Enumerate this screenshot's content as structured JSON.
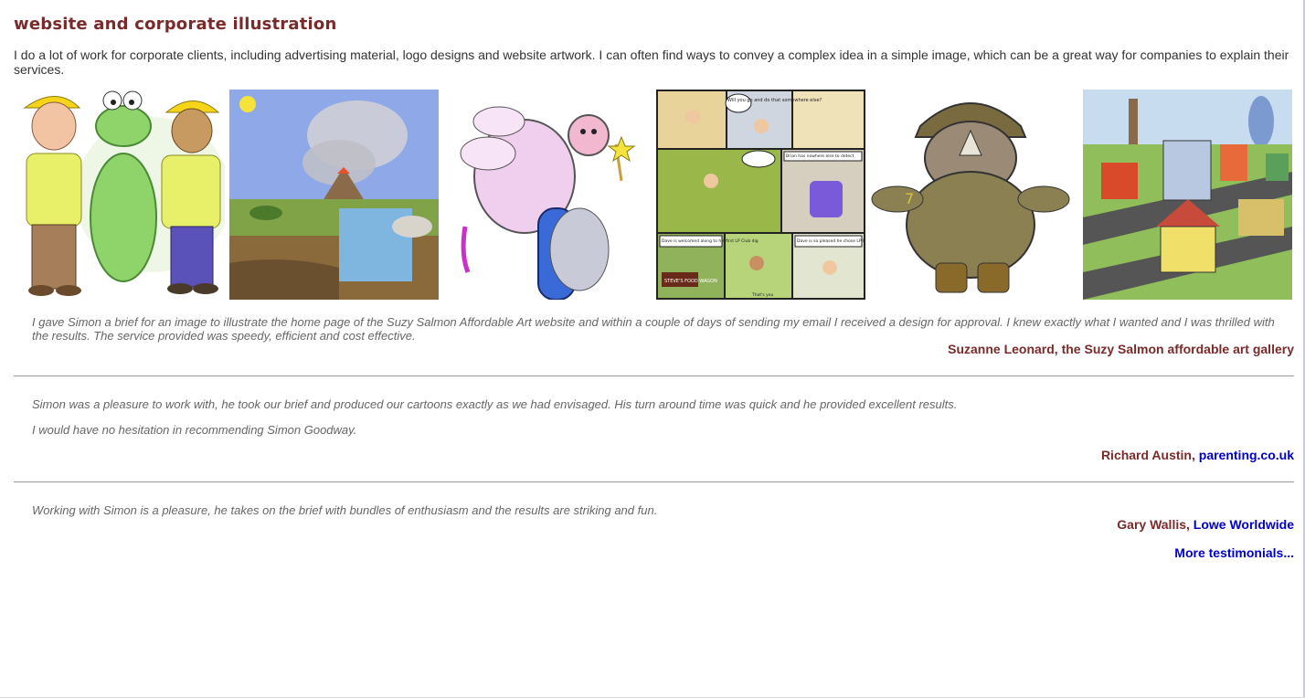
{
  "heading": "website and corporate illustration",
  "intro": "I do a lot of work for corporate clients, including advertising material, logo designs and website artwork. I can often find ways to convey a complex idea in a simple image, which can be a great way for companies to explain their services.",
  "gallery": [
    {
      "icon": "construction-workers-crocodile-icon"
    },
    {
      "icon": "prehistoric-volcano-landscape-icon"
    },
    {
      "icon": "flying-pig-fairy-icon"
    },
    {
      "icon": "comic-strip-icon",
      "captions": [
        "Will you go and do that somewhere else?",
        "Brian has nowhere else to detect",
        "Dave is welcomed along to his first LP Club dig",
        "Dave is so pleased he chose LP Metal Detecting",
        "STEVE'S FOOD WAGON",
        "That's you"
      ]
    },
    {
      "icon": "rhino-soldier-icon",
      "badge": "7"
    },
    {
      "icon": "london-city-aerial-icon"
    }
  ],
  "testimonials": [
    {
      "paragraphs": [
        "I gave Simon a brief for an image to illustrate the home page of the Suzy Salmon Affordable Art website and within a couple of days of sending my email I received a design for approval. I knew exactly what I wanted and I was thrilled with the results. The service provided was speedy, efficient and cost effective."
      ],
      "author": "Suzanne Leonard, the Suzy Salmon affordable art gallery",
      "link": ""
    },
    {
      "paragraphs": [
        "Simon was a pleasure to work with, he took our brief and produced our cartoons exactly as we had envisaged. His turn around time was quick and he provided excellent results.",
        "I would have no hesitation in recommending Simon Goodway."
      ],
      "author": "Richard Austin, ",
      "link": "parenting.co.uk"
    },
    {
      "paragraphs": [
        "Working with Simon is a pleasure, he takes on the brief with bundles of enthusiasm and the results are striking and fun."
      ],
      "author": "Gary Wallis, ",
      "link": "Lowe Worldwide"
    }
  ],
  "more_link": "More testimonials..."
}
